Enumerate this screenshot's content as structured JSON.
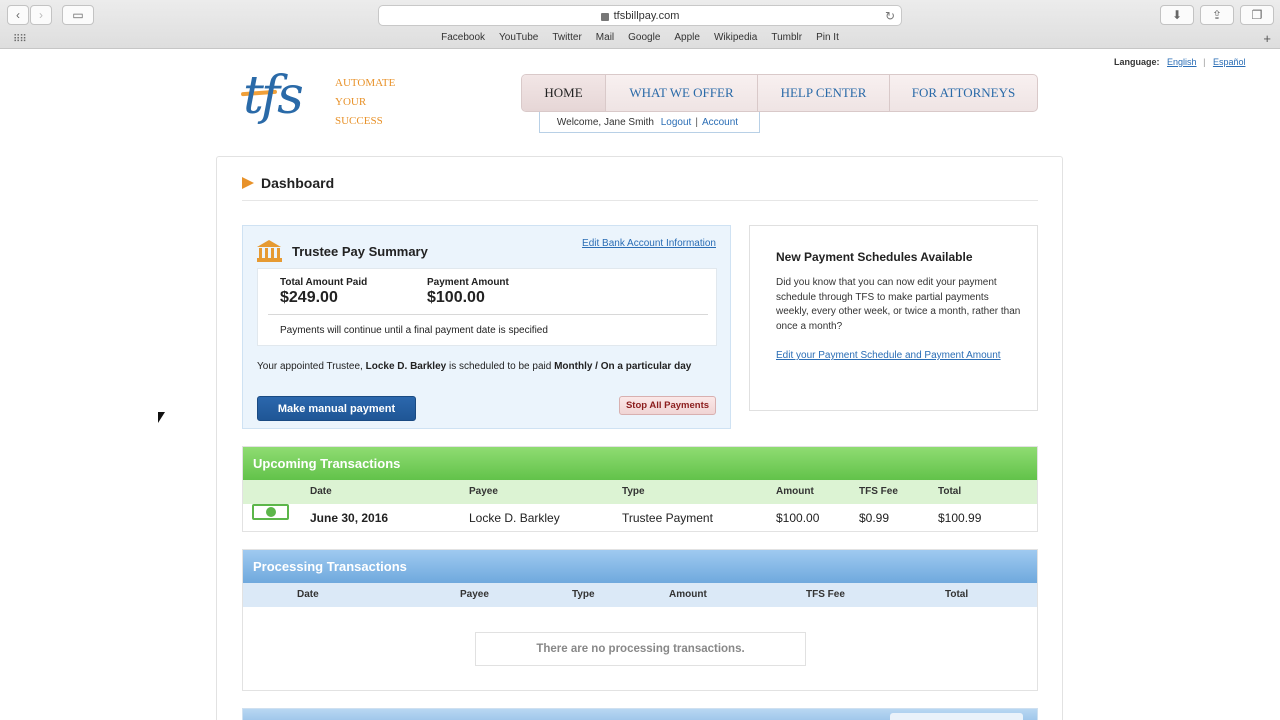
{
  "browser": {
    "url": "tfsbillpay.com",
    "bookmarks": [
      "Facebook",
      "YouTube",
      "Twitter",
      "Mail",
      "Google",
      "Apple",
      "Wikipedia",
      "Tumblr",
      "Pin It"
    ]
  },
  "language": {
    "label": "Language:",
    "english": "English",
    "spanish": "Español"
  },
  "logo": {
    "brand": "tfs",
    "tagline": [
      "AUTOMATE",
      "YOUR",
      "SUCCESS"
    ]
  },
  "nav": {
    "home": "HOME",
    "offer": "WHAT WE OFFER",
    "help": "HELP CENTER",
    "attorneys": "FOR ATTORNEYS"
  },
  "account": {
    "welcome": "Welcome, Jane Smith",
    "logout": "Logout",
    "account": "Account"
  },
  "dashboard": {
    "title": "Dashboard"
  },
  "summary": {
    "title": "Trustee Pay Summary",
    "edit_link": "Edit Bank Account Information",
    "total_paid_label": "Total Amount Paid",
    "total_paid_value": "$249.00",
    "payment_amount_label": "Payment Amount",
    "payment_amount_value": "$100.00",
    "note": "Payments will continue until a final payment date is specified",
    "schedule_prefix": "Your appointed Trustee, ",
    "trustee_name": "Locke D. Barkley",
    "schedule_mid": " is scheduled to be paid ",
    "schedule_freq": "Monthly / On a particular day",
    "manual_button": "Make manual payment",
    "stop_button": "Stop All Payments"
  },
  "new_schedules": {
    "title": "New Payment Schedules Available",
    "body": "Did you know that you can now edit your payment schedule through TFS to make partial payments weekly, every other week, or twice a month, rather than once a month?",
    "link": "Edit your Payment Schedule and Payment Amount"
  },
  "upcoming": {
    "title": "Upcoming Transactions",
    "columns": [
      "Date",
      "Payee",
      "Type",
      "Amount",
      "TFS Fee",
      "Total"
    ],
    "rows": [
      {
        "date": "June 30, 2016",
        "payee": "Locke D. Barkley",
        "type": "Trustee Payment",
        "amount": "$100.00",
        "fee": "$0.99",
        "total": "$100.99"
      }
    ]
  },
  "processing": {
    "title": "Processing Transactions",
    "columns": [
      "Date",
      "Payee",
      "Type",
      "Amount",
      "TFS Fee",
      "Total"
    ],
    "empty": "There are no processing transactions."
  },
  "colors": {
    "brand_blue": "#2a6aa8",
    "accent_orange": "#e8922a",
    "upcoming_green": "#62c24a",
    "processing_blue": "#6fa9dd"
  }
}
